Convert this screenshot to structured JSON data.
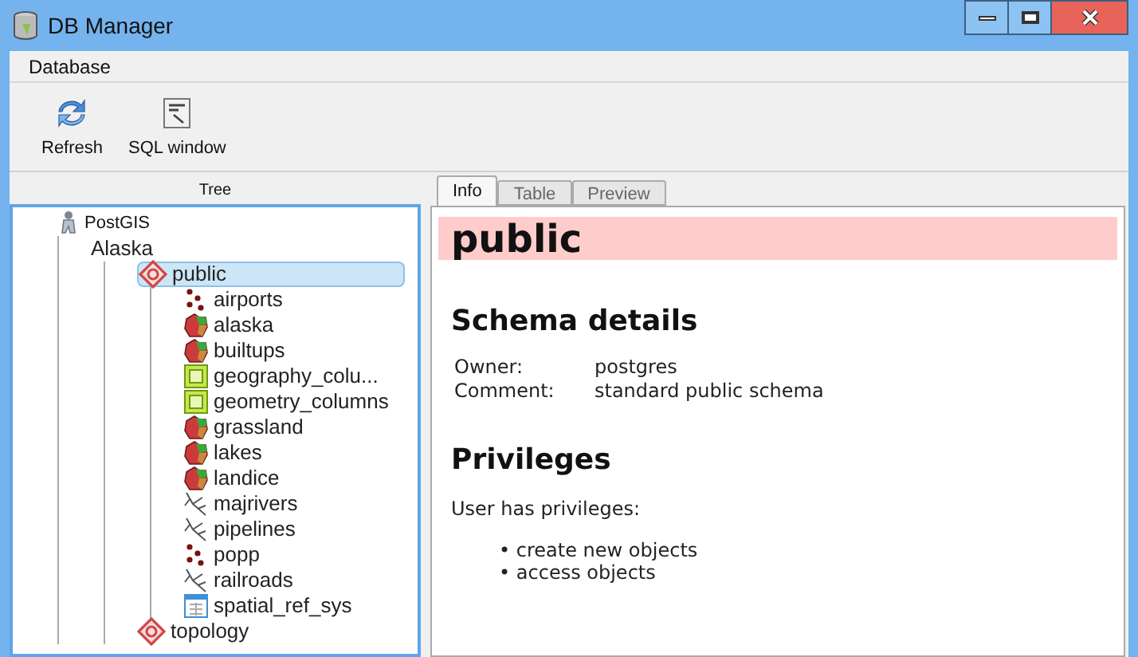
{
  "window": {
    "title": "DB Manager"
  },
  "menu": [
    "Database"
  ],
  "toolbar": [
    {
      "kind": "refresh",
      "label": "Refresh"
    },
    {
      "kind": "sql",
      "label": "SQL window"
    }
  ],
  "tree": {
    "title": "Tree",
    "items": [
      {
        "label": "PostGIS",
        "kind": "connection",
        "selected": false,
        "children": [
          {
            "label": "Alaska",
            "selected": false,
            "children": [
              {
                "label": "public",
                "kind": "schema",
                "selected": true,
                "children": [
                  {
                    "label": "airports",
                    "kind": "point",
                    "selected": false
                  },
                  {
                    "label": "alaska",
                    "kind": "polygon",
                    "selected": false
                  },
                  {
                    "label": "builtups",
                    "kind": "polygon",
                    "selected": false
                  },
                  {
                    "label": "geography_colu...",
                    "kind": "view",
                    "selected": false
                  },
                  {
                    "label": "geometry_columns",
                    "kind": "view",
                    "selected": false
                  },
                  {
                    "label": "grassland",
                    "kind": "polygon",
                    "selected": false
                  },
                  {
                    "label": "lakes",
                    "kind": "polygon",
                    "selected": false
                  },
                  {
                    "label": "landice",
                    "kind": "polygon",
                    "selected": false
                  },
                  {
                    "label": "majrivers",
                    "kind": "line",
                    "selected": false
                  },
                  {
                    "label": "pipelines",
                    "kind": "line",
                    "selected": false
                  },
                  {
                    "label": "popp",
                    "kind": "point",
                    "selected": false
                  },
                  {
                    "label": "railroads",
                    "kind": "line",
                    "selected": false
                  },
                  {
                    "label": "spatial_ref_sys",
                    "kind": "table",
                    "selected": false
                  }
                ]
              },
              {
                "label": "topology",
                "kind": "schema",
                "selected": false
              }
            ]
          }
        ]
      }
    ]
  },
  "tabs": [
    {
      "label": "Info",
      "selected": true
    },
    {
      "label": "Table",
      "selected": false
    },
    {
      "label": "Preview",
      "selected": false
    }
  ],
  "info": {
    "title": "public",
    "section": "Schema details",
    "details": [
      {
        "label": "Owner:",
        "value": "postgres"
      },
      {
        "label": "Comment:",
        "value": "standard public schema"
      }
    ],
    "privileges_title": "Privileges",
    "privileges_intro": "User has privileges:",
    "privileges": [
      "• create new objects",
      "• access objects"
    ]
  }
}
